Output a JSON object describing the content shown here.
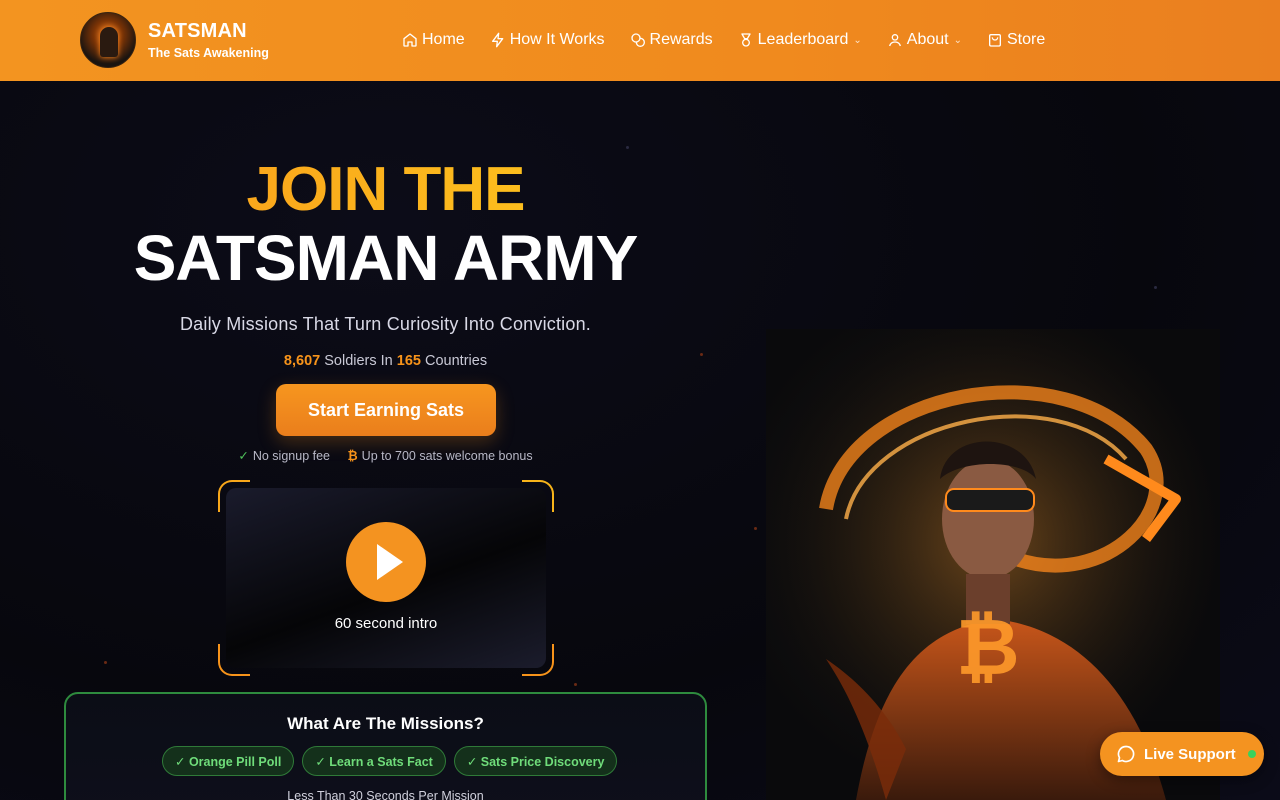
{
  "brand": {
    "name": "SATSMAN",
    "tagline": "The Sats Awakening"
  },
  "nav": {
    "items": [
      {
        "label": "Home",
        "icon": "home-icon"
      },
      {
        "label": "How It Works",
        "icon": "lightning-icon"
      },
      {
        "label": "Rewards",
        "icon": "coins-icon"
      },
      {
        "label": "Leaderboard",
        "icon": "medal-icon",
        "dropdown": true
      },
      {
        "label": "About",
        "icon": "user-icon",
        "dropdown": true
      },
      {
        "label": "Store",
        "icon": "bag-icon"
      }
    ]
  },
  "hero": {
    "headline_line1": "JOIN THE",
    "headline_line2": "SATSMAN ARMY",
    "subtitle": "Daily Missions That Turn Curiosity Into Conviction.",
    "stats": {
      "soldiers": "8,607",
      "soldiers_label": "Soldiers In",
      "countries": "165",
      "countries_label": "Countries"
    },
    "cta_label": "Start Earning Sats",
    "perks": {
      "check": "✓",
      "no_fee": "No signup fee",
      "bitcoin_symbol": "₿",
      "bonus": "Up to 700 sats welcome bonus"
    }
  },
  "video": {
    "label": "60 second intro"
  },
  "missions": {
    "title": "What Are The Missions?",
    "pills": [
      "✓ Orange Pill Poll",
      "✓ Learn a Sats Fact",
      "✓ Sats Price Discovery"
    ],
    "note": "Less Than 30 Seconds Per Mission"
  },
  "support": {
    "label": "Live Support"
  },
  "colors": {
    "accent": "#f7931a",
    "header": "#f39420",
    "success": "#3ad15c",
    "background": "#0b0b14"
  }
}
